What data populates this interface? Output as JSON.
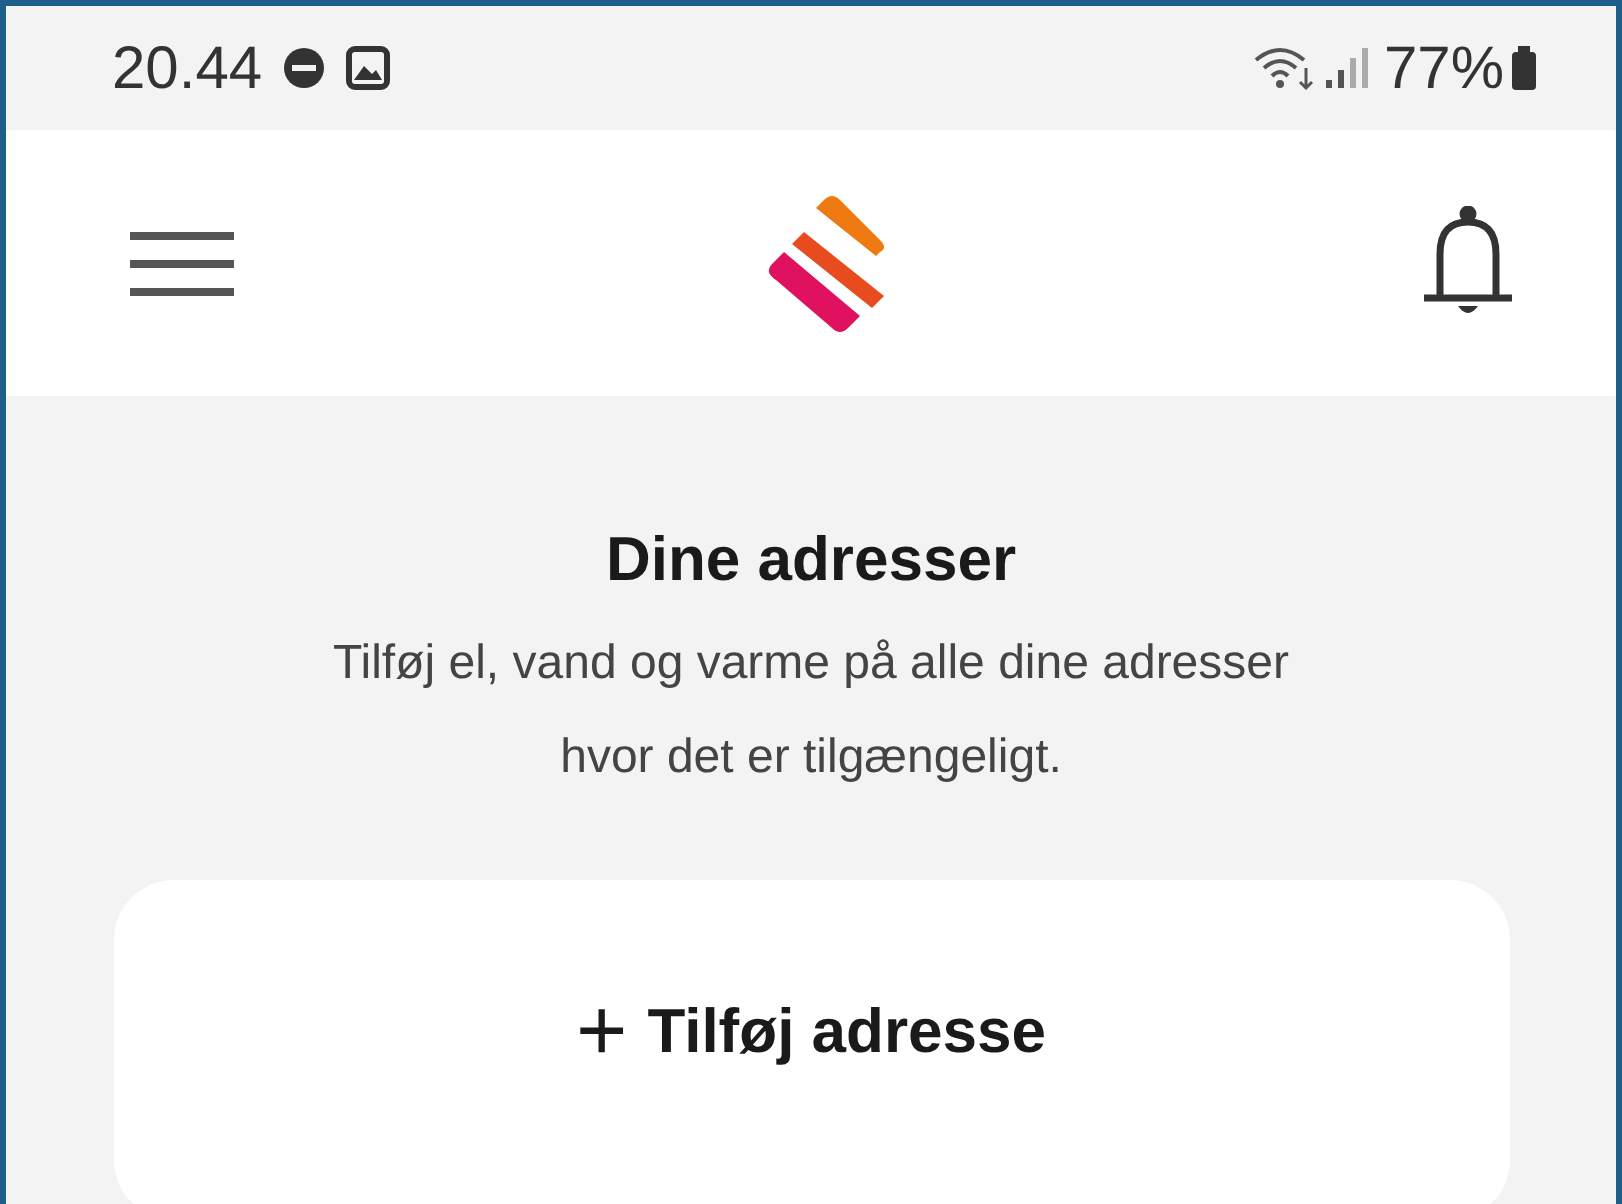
{
  "status_bar": {
    "time": "20.44",
    "battery": "77%"
  },
  "content": {
    "title": "Dine adresser",
    "description": "Tilføj el, vand og varme på alle dine adresser hvor det er tilgængeligt.",
    "add_button": {
      "icon": "+",
      "label": "Tilføj adresse"
    }
  }
}
